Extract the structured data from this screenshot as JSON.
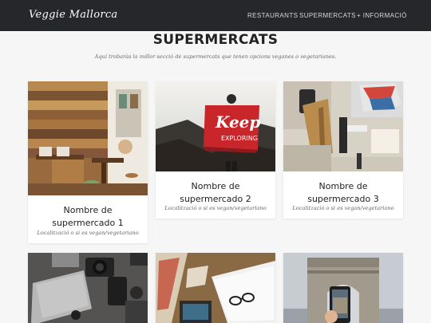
{
  "brand": "Veggie Mallorca",
  "nav": {
    "items": [
      "RESTAURANTS",
      "SUPERMERCATS",
      "+ INFORMACIÓ"
    ]
  },
  "header": {
    "title": "SUPERMERCATS",
    "subtitle": "Aquí trobaràs la millor secció de supermercats que tenen opcions veganes o vegetarianes."
  },
  "cards": [
    {
      "title_line1": "Nombre de",
      "title_line2": "supermercado 1",
      "subtitle": "Localització o si es vegan/vegetariano"
    },
    {
      "title_line1": "Nombre de",
      "title_line2": "supermercado 2",
      "subtitle": "Localització o si es vegan/vegetariano"
    },
    {
      "title_line1": "Nombre de",
      "title_line2": "supermercado 3",
      "subtitle": "Localització o si es vegan/vegetariano"
    }
  ],
  "images": {
    "flag_text_1": "Keep",
    "flag_text_2": "EXPLORING"
  },
  "colors": {
    "navbar": "#25272b",
    "page_bg": "#f6f6f6",
    "flag_red": "#c8262a"
  }
}
